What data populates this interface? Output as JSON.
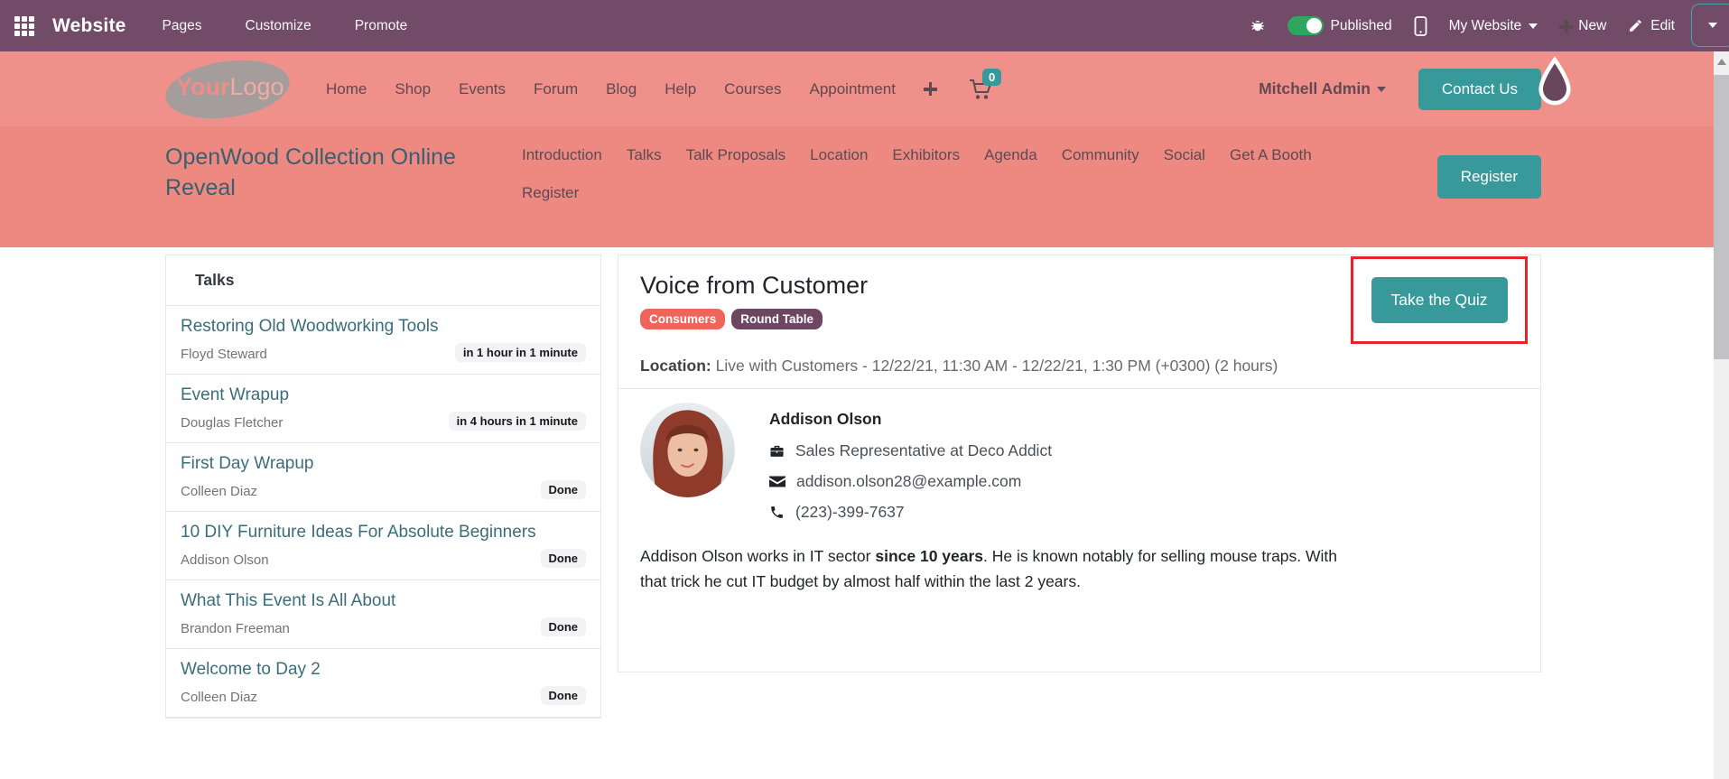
{
  "topbar": {
    "app_label": "Website",
    "menu": [
      "Pages",
      "Customize",
      "Promote"
    ],
    "published_label": "Published",
    "website_selector": "My Website",
    "new_label": "New",
    "edit_label": "Edit"
  },
  "header": {
    "logo": {
      "part1": "Your",
      "part2": "Logo"
    },
    "nav": [
      "Home",
      "Shop",
      "Events",
      "Forum",
      "Blog",
      "Help",
      "Courses",
      "Appointment"
    ],
    "cart_count": "0",
    "user": "Mitchell Admin",
    "contact_button": "Contact Us"
  },
  "event_banner": {
    "title": "OpenWood Collection Online Reveal",
    "nav_row1": [
      "Introduction",
      "Talks",
      "Talk Proposals",
      "Location",
      "Exhibitors",
      "Agenda",
      "Community",
      "Social",
      "Get A Booth"
    ],
    "nav_row2": [
      "Register"
    ],
    "register_button": "Register"
  },
  "sidebar": {
    "title": "Talks",
    "talks": [
      {
        "title": "Restoring Old Woodworking Tools",
        "speaker": "Floyd Steward",
        "status": "in 1 hour in 1 minute"
      },
      {
        "title": "Event Wrapup",
        "speaker": "Douglas Fletcher",
        "status": "in 4 hours in 1 minute"
      },
      {
        "title": "First Day Wrapup",
        "speaker": "Colleen Diaz",
        "status": "Done"
      },
      {
        "title": "10 DIY Furniture Ideas For Absolute Beginners",
        "speaker": "Addison Olson",
        "status": "Done"
      },
      {
        "title": "What This Event Is All About",
        "speaker": "Brandon Freeman",
        "status": "Done"
      },
      {
        "title": "Welcome to Day 2",
        "speaker": "Colleen Diaz",
        "status": "Done"
      }
    ]
  },
  "main": {
    "title": "Voice from Customer",
    "badges": [
      {
        "label": "Consumers",
        "color": "#f0655b"
      },
      {
        "label": "Round Table",
        "color": "#6d4661"
      }
    ],
    "quiz_button": "Take the Quiz",
    "location_label": "Location:",
    "location_value": " Live with Customers - 12/22/21, 11:30 AM - 12/22/21, 1:30 PM (+0300) (2 hours)",
    "speaker": {
      "name": "Addison Olson",
      "role": "Sales Representative at Deco Addict",
      "email": "addison.olson28@example.com",
      "phone": "(223)-399-7637",
      "bio_before": "Addison Olson works in IT sector ",
      "bio_bold": "since 10 years",
      "bio_after": ". He is known notably for selling mouse traps. With that trick he cut IT budget by almost half within the last 2 years."
    }
  },
  "colors": {
    "topbar_purple": "#714B67",
    "header_salmon": "#f0908a",
    "banner_salmon": "#ee8982",
    "accent_teal": "#38999b",
    "badge_red": "#f0655b",
    "badge_purple": "#6d4661",
    "annotation_red": "#e5242a",
    "link_teal": "#3a6d7c",
    "toggle_green": "#2ea65f"
  }
}
